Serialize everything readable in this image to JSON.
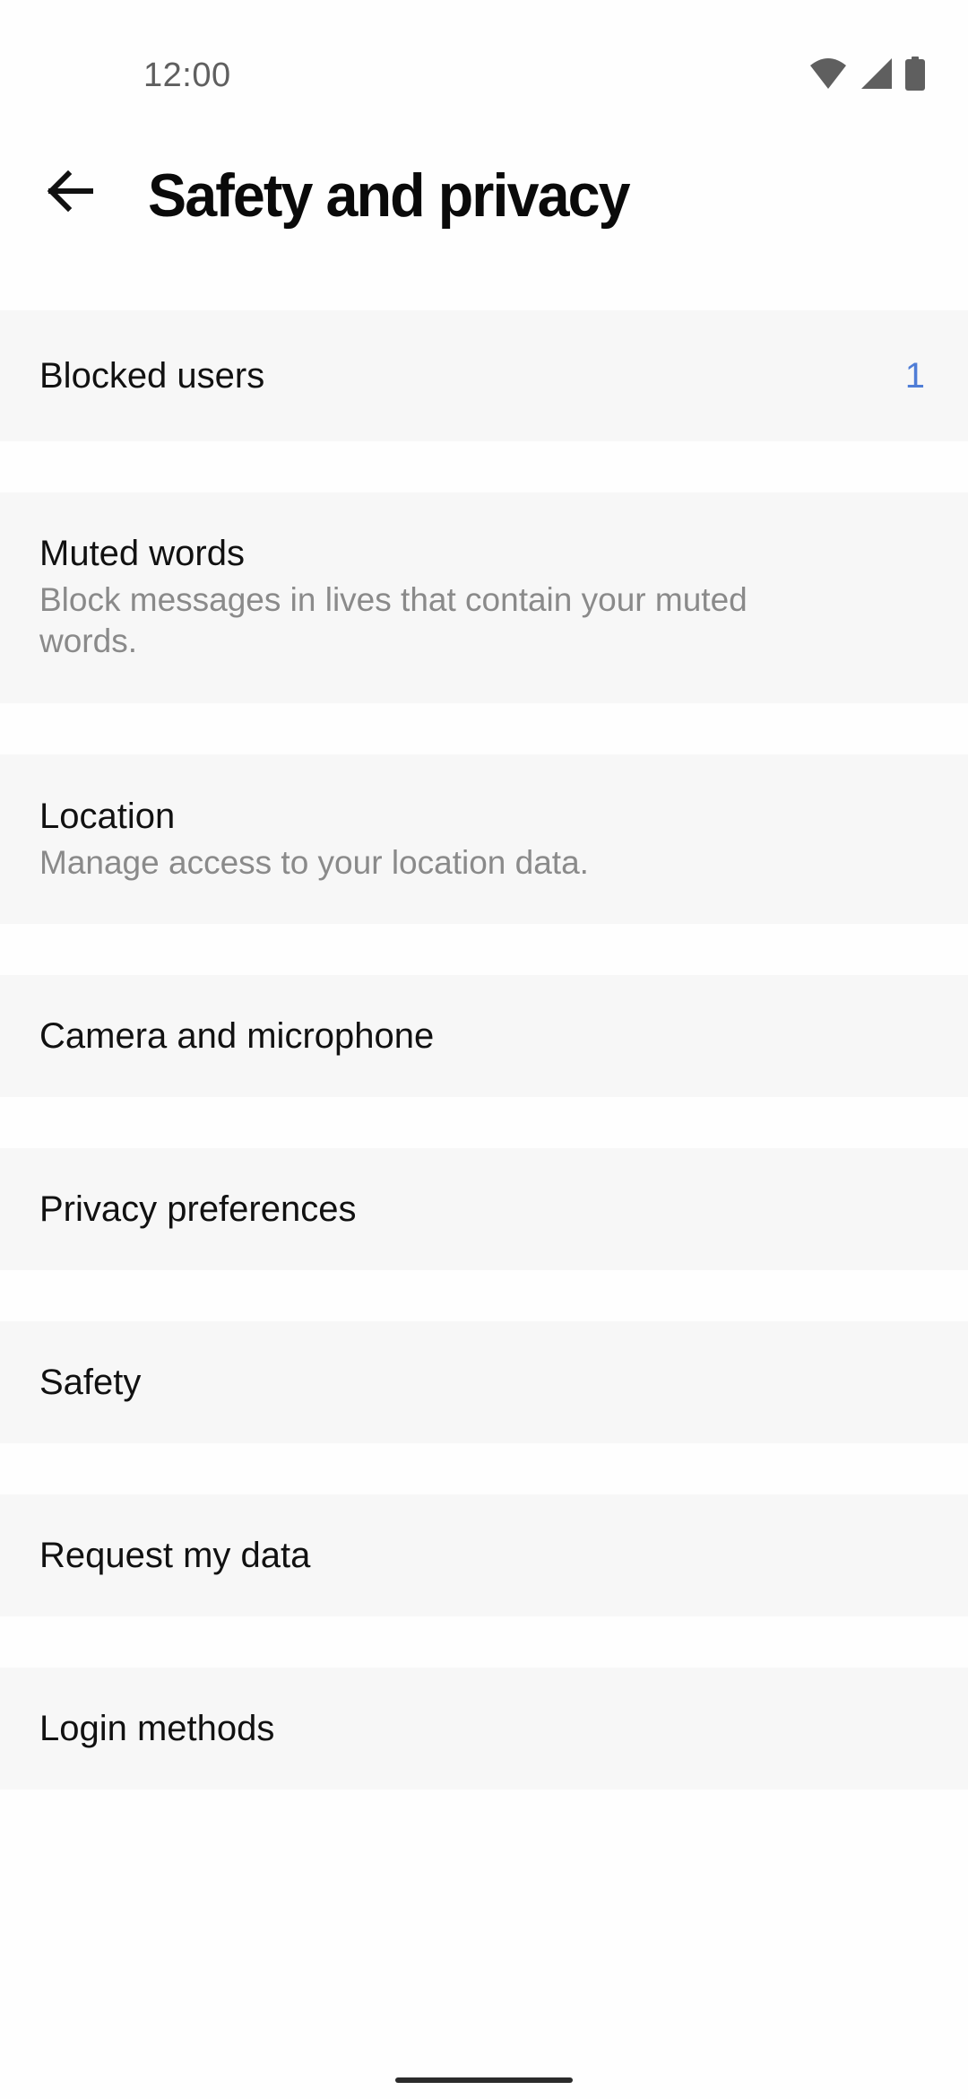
{
  "status_bar": {
    "time": "12:00",
    "icons": [
      "wifi-icon",
      "cellular-signal-icon",
      "battery-icon"
    ]
  },
  "header": {
    "back_icon": "arrow-left-icon",
    "title": "Safety and privacy"
  },
  "settings": {
    "items": [
      {
        "title": "Blocked users",
        "badge": "1"
      },
      {
        "title": "Muted words",
        "subtitle": "Block messages in lives that contain your muted words."
      },
      {
        "title": "Location",
        "subtitle": "Manage access to your location data."
      },
      {
        "title": "Camera and microphone"
      },
      {
        "title": "Privacy preferences"
      },
      {
        "title": "Safety"
      },
      {
        "title": "Request my data"
      },
      {
        "title": "Login methods"
      }
    ]
  },
  "colors": {
    "background": "#FEFEFE",
    "row_background": "#F7F7F7",
    "badge_accent": "#4F7DD6",
    "primary_text": "#111111",
    "secondary_text": "#8A8A8A"
  }
}
